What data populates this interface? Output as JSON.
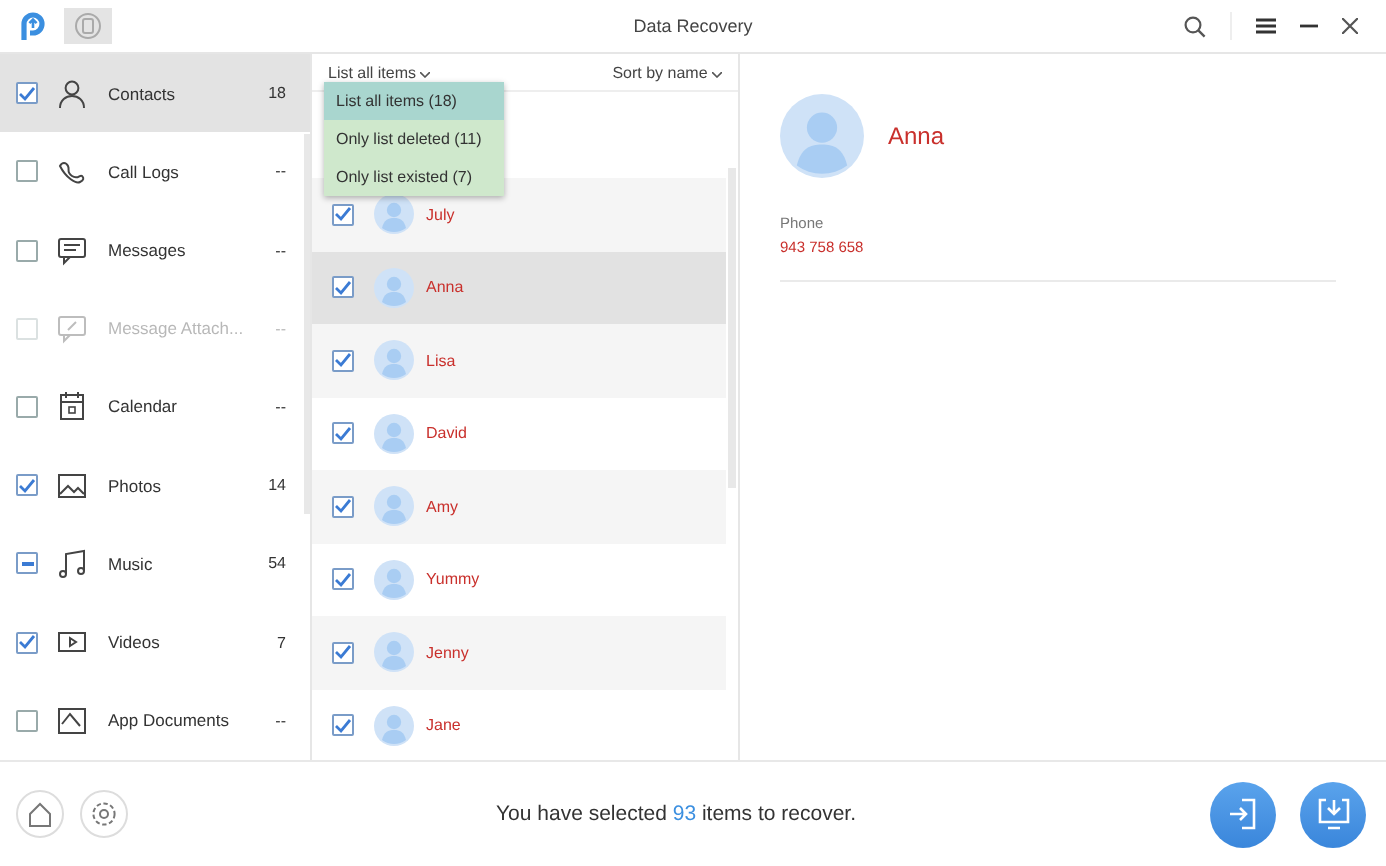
{
  "window": {
    "title": "Data Recovery"
  },
  "sidebar": {
    "items": [
      {
        "label": "Contacts",
        "count": "18",
        "checked": true,
        "partial": false,
        "disabled": false,
        "selected": true
      },
      {
        "label": "Call Logs",
        "count": "--",
        "checked": false,
        "partial": false,
        "disabled": false,
        "selected": false
      },
      {
        "label": "Messages",
        "count": "--",
        "checked": false,
        "partial": false,
        "disabled": false,
        "selected": false
      },
      {
        "label": "Message Attach...",
        "count": "--",
        "checked": false,
        "partial": false,
        "disabled": true,
        "selected": false
      },
      {
        "label": "Calendar",
        "count": "--",
        "checked": false,
        "partial": false,
        "disabled": false,
        "selected": false
      },
      {
        "label": "Photos",
        "count": "14",
        "checked": true,
        "partial": false,
        "disabled": false,
        "selected": false
      },
      {
        "label": "Music",
        "count": "54",
        "checked": false,
        "partial": true,
        "disabled": false,
        "selected": false
      },
      {
        "label": "Videos",
        "count": "7",
        "checked": true,
        "partial": false,
        "disabled": false,
        "selected": false
      },
      {
        "label": "App Documents",
        "count": "--",
        "checked": false,
        "partial": false,
        "disabled": false,
        "selected": false
      }
    ]
  },
  "list": {
    "filter": "List all items",
    "sort": "Sort by name",
    "filter_menu": [
      {
        "label": "List all items (18)",
        "selected": true
      },
      {
        "label": "Only list deleted (11)",
        "selected": false
      },
      {
        "label": "Only list existed (7)",
        "selected": false
      }
    ],
    "rows": [
      {
        "name": "July",
        "checked": true,
        "selected": false
      },
      {
        "name": "Anna",
        "checked": true,
        "selected": true
      },
      {
        "name": "Lisa",
        "checked": true,
        "selected": false
      },
      {
        "name": "David",
        "checked": true,
        "selected": false
      },
      {
        "name": "Amy",
        "checked": true,
        "selected": false
      },
      {
        "name": "Yummy",
        "checked": true,
        "selected": false
      },
      {
        "name": "Jenny",
        "checked": true,
        "selected": false
      },
      {
        "name": "Jane",
        "checked": true,
        "selected": false
      }
    ]
  },
  "detail": {
    "name": "Anna",
    "field_label": "Phone",
    "field_value": "943 758 658"
  },
  "footer": {
    "message": "You have selected **93** items to recover."
  }
}
